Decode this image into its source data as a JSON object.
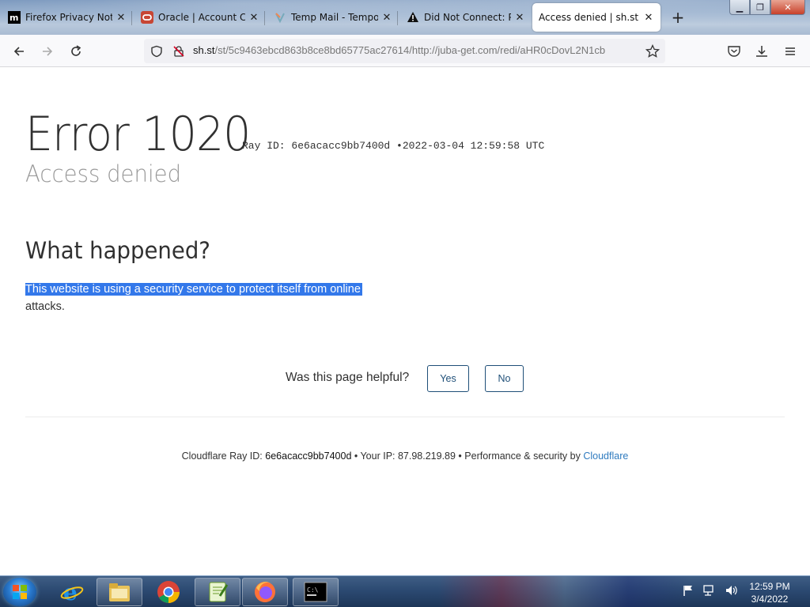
{
  "browser": {
    "tabs": [
      {
        "label": "Firefox Privacy Notice",
        "icon": "mozilla-icon"
      },
      {
        "label": "Oracle | Account Con",
        "icon": "oracle-icon"
      },
      {
        "label": "Temp Mail - Tempor",
        "icon": "tempmail-icon"
      },
      {
        "label": "Did Not Connect: Po",
        "icon": "warning-icon"
      },
      {
        "label": "Access denied | sh.st use",
        "icon": "none",
        "active": true
      }
    ],
    "url_host": "sh.st",
    "url_rest": "/st/5c9463ebcd863b8ce8bd65775ac27614/http://juba-get.com/redi/aHR0cDovL2N1cb"
  },
  "page": {
    "title": "Error 1020",
    "ray_label": "Ray ID: 6e6acacc9bb7400d",
    "bullet": "•",
    "timestamp": "2022-03-04 12:59:58 UTC",
    "subtitle": "Access denied",
    "section_heading": "What happened?",
    "para_highlighted": "This website is using a security service to protect itself from online",
    "para_rest": "attacks.",
    "helpful_question": "Was this page helpful?",
    "yes_label": "Yes",
    "no_label": "No",
    "footer": {
      "ray_prefix": "Cloudflare Ray ID: ",
      "ray_id": "6e6acacc9bb7400d",
      "ip_text": " • Your IP: 87.98.219.89 • Performance & security by ",
      "cloudflare_link": "Cloudflare"
    }
  },
  "taskbar": {
    "time": "12:59 PM",
    "date": "3/4/2022",
    "apps": [
      "internet-explorer-icon",
      "file-explorer-icon",
      "chrome-icon",
      "notepadpp-icon",
      "firefox-icon",
      "cmd-icon"
    ]
  },
  "colors": {
    "selection": "#3378ea",
    "link": "#2f7bbf",
    "button_border": "#1f4f78"
  }
}
